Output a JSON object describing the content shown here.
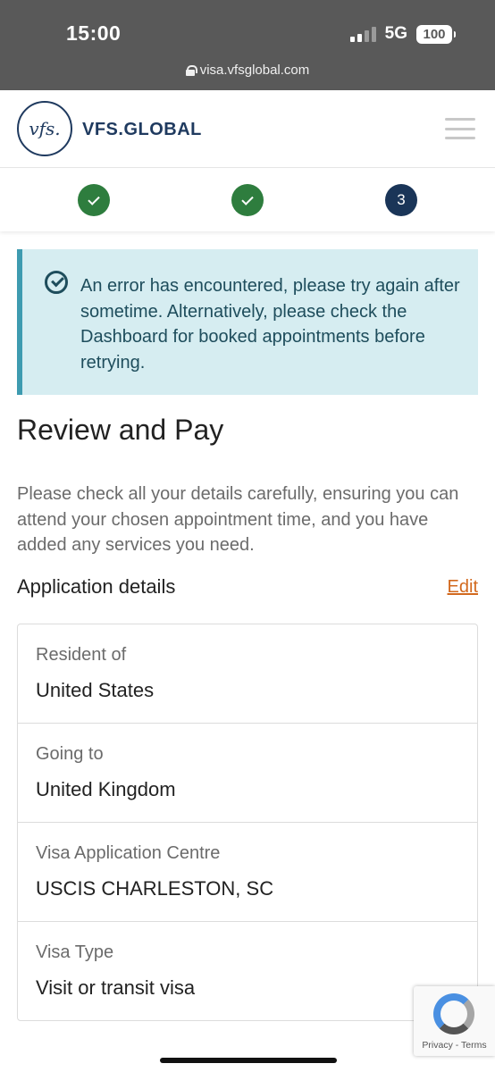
{
  "status_bar": {
    "time": "15:00",
    "network": "5G",
    "battery": "100"
  },
  "browser": {
    "url": "visa.vfsglobal.com"
  },
  "header": {
    "logo_mark": "vfs.",
    "brand": "VFS.GLOBAL"
  },
  "stepper": {
    "current_step_label": "3"
  },
  "alert": {
    "message": "An error has encountered, please try again after sometime. Alternatively, please check the Dashboard for booked appointments before retrying."
  },
  "page": {
    "title": "Review and Pay",
    "intro": "Please check all your details carefully, ensuring you can attend your chosen appointment time, and you have added any services you need."
  },
  "application_details": {
    "section_title": "Application details",
    "edit_label": "Edit",
    "rows": [
      {
        "label": "Resident of",
        "value": "United States"
      },
      {
        "label": "Going to",
        "value": "United Kingdom"
      },
      {
        "label": "Visa Application Centre",
        "value": "USCIS CHARLESTON, SC"
      },
      {
        "label": "Visa Type",
        "value": "Visit or transit visa"
      }
    ]
  },
  "recaptcha": {
    "links": "Privacy - Terms"
  },
  "colors": {
    "brand_navy": "#1f3a5f",
    "step_done": "#2e7d3e",
    "step_current": "#1a3558",
    "alert_bg": "#d6edf1",
    "edit_link": "#d2691e"
  }
}
